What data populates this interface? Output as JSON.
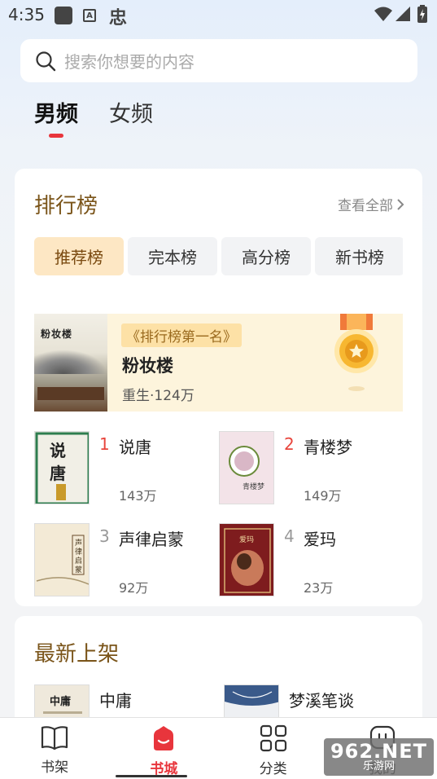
{
  "status_bar": {
    "time": "4:35",
    "a_label": "A",
    "bug_glyph": "忠"
  },
  "search": {
    "placeholder": "搜索你想要的内容"
  },
  "gender_tabs": [
    {
      "label": "男频",
      "active": true
    },
    {
      "label": "女频",
      "active": false
    }
  ],
  "ranking": {
    "title": "排行榜",
    "view_all": "查看全部",
    "tabs": [
      {
        "label": "推荐榜",
        "active": true
      },
      {
        "label": "完本榜",
        "active": false
      },
      {
        "label": "高分榜",
        "active": false
      },
      {
        "label": "新书榜",
        "active": false
      }
    ],
    "top": {
      "badge": "《排行榜第一名》",
      "name": "粉妆楼",
      "meta": "重生·124万",
      "cover_text": "粉妆楼"
    },
    "books": [
      {
        "rank": "1",
        "name": "说唐",
        "count": "143万"
      },
      {
        "rank": "2",
        "name": "青楼梦",
        "count": "149万"
      },
      {
        "rank": "3",
        "name": "声律启蒙",
        "count": "92万"
      },
      {
        "rank": "4",
        "name": "爱玛",
        "count": "23万"
      }
    ]
  },
  "new_arrivals": {
    "title": "最新上架",
    "books": [
      {
        "name": "中庸"
      },
      {
        "name": "梦溪笔谈"
      }
    ]
  },
  "bottom_nav": [
    {
      "label": "书架",
      "icon": "book-open-icon",
      "active": false
    },
    {
      "label": "书城",
      "icon": "store-icon",
      "active": true
    },
    {
      "label": "分类",
      "icon": "grid-icon",
      "active": false
    },
    {
      "label": "我的",
      "icon": "profile-icon",
      "active": false
    }
  ],
  "watermark": {
    "big": "962.NET",
    "small": "乐游网"
  },
  "colors": {
    "accent_red": "#e8353c",
    "title_brown": "#7a5419",
    "active_tab_bg": "#fde7c4",
    "top_book_bg": "#fdf4dc"
  }
}
